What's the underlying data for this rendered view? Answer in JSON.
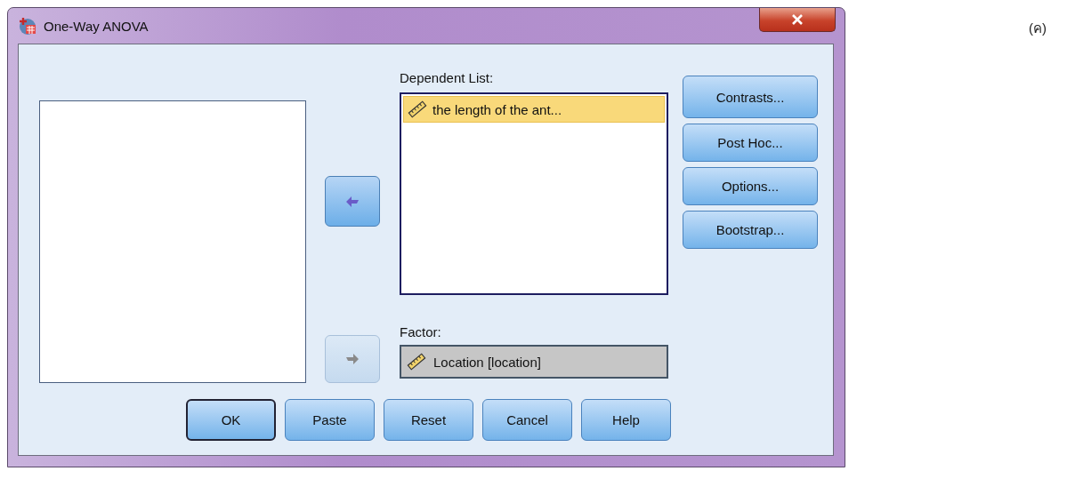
{
  "window": {
    "title": "One-Way ANOVA"
  },
  "move_buttons": [
    {
      "kind": "left",
      "disabled": false
    },
    {
      "kind": "right",
      "disabled": true
    }
  ],
  "dependent_list": {
    "label": "Dependent List:",
    "items": [
      {
        "text": "the length of the ant...",
        "selected": true
      }
    ]
  },
  "factor": {
    "label": "Factor:",
    "value": "Location [location]"
  },
  "side_buttons": [
    {
      "label": "Contrasts..."
    },
    {
      "label": "Post Hoc..."
    },
    {
      "label": "Options..."
    },
    {
      "label": "Bootstrap..."
    }
  ],
  "bottom_buttons": [
    {
      "label": "OK",
      "default": true
    },
    {
      "label": "Paste",
      "default": false
    },
    {
      "label": "Reset",
      "default": false
    },
    {
      "label": "Cancel",
      "default": false
    },
    {
      "label": "Help",
      "default": false
    }
  ],
  "caption": "(ค)"
}
